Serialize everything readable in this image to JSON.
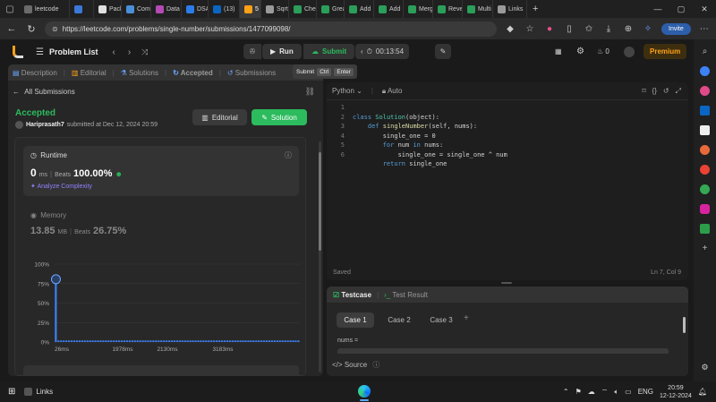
{
  "browser": {
    "tabs": [
      {
        "label": "leetcode",
        "color": "#6b6b6b",
        "active": false
      },
      {
        "label": "",
        "color": "#3b78d8",
        "active": false
      },
      {
        "label": "Packa",
        "color": "#e0e0e0",
        "active": false
      },
      {
        "label": "Com",
        "color": "#4a90d9",
        "active": false
      },
      {
        "label": "Data",
        "color": "#b44ab4",
        "active": false
      },
      {
        "label": "DSA",
        "color": "#2b7de9",
        "active": false
      },
      {
        "label": "(13)",
        "color": "#0a66c2",
        "active": false
      },
      {
        "label": "5",
        "color": "#ffa116",
        "active": true
      },
      {
        "label": "Sqrti",
        "color": "#9a9a9a",
        "active": false
      },
      {
        "label": "Chec",
        "color": "#2b9e5a",
        "active": false
      },
      {
        "label": "Grea",
        "color": "#2b9e5a",
        "active": false
      },
      {
        "label": "Add",
        "color": "#2b9e5a",
        "active": false
      },
      {
        "label": "Add",
        "color": "#2b9e5a",
        "active": false
      },
      {
        "label": "Merg",
        "color": "#2b9e5a",
        "active": false
      },
      {
        "label": "Reve",
        "color": "#2b9e5a",
        "active": false
      },
      {
        "label": "Multi",
        "color": "#2b9e5a",
        "active": false
      },
      {
        "label": "Links",
        "color": "#9a9a9a",
        "active": false
      }
    ],
    "url": "https://leetcode.com/problems/single-number/submissions/1477099098/",
    "invite_label": "Invite"
  },
  "lc_header": {
    "problem_list": "Problem List",
    "run": "Run",
    "submit": "Submit",
    "timer": "00:13:54",
    "streak": "0",
    "premium": "Premium"
  },
  "left_tabs": [
    "Description",
    "Editorial",
    "Solutions",
    "Accepted",
    "Submissions"
  ],
  "shortcut": {
    "label": "Submit",
    "k1": "Ctrl",
    "k2": "Enter"
  },
  "submission": {
    "back": "All Submissions",
    "status": "Accepted",
    "user": "Hariprasath7",
    "submitted": "submitted at Dec 12, 2024 20:59",
    "editorial_btn": "Editorial",
    "solution_btn": "Solution"
  },
  "runtime": {
    "title": "Runtime",
    "value": "0",
    "unit": "ms",
    "beats_label": "Beats",
    "beats_value": "100.00%",
    "analyze": "Analyze Complexity"
  },
  "memory": {
    "title": "Memory",
    "value": "13.85",
    "unit": "MB",
    "beats_label": "Beats",
    "beats_value": "26.75%"
  },
  "chart_data": {
    "type": "bar",
    "title": "",
    "y_ticks": [
      "100%",
      "75%",
      "50%",
      "25%",
      "0%"
    ],
    "x_ticks": [
      "26ms",
      "1978ms",
      "2130ms",
      "3183ms"
    ],
    "ylim": [
      0,
      100
    ],
    "values": [
      76,
      2,
      2,
      2,
      2,
      2,
      2,
      2,
      2,
      2,
      2,
      2,
      2,
      2,
      2,
      2,
      2,
      2,
      2,
      2,
      2,
      2,
      2,
      2,
      2,
      2,
      2,
      2,
      2,
      2,
      2,
      2,
      2,
      2,
      2,
      2,
      2,
      2,
      2,
      2,
      2,
      2,
      2,
      2,
      2,
      2,
      2,
      2,
      2,
      2,
      2,
      2,
      2,
      2,
      2,
      2,
      2,
      2,
      2,
      2,
      2,
      2,
      2,
      2,
      2,
      2,
      2,
      2,
      2,
      2,
      2,
      2,
      2,
      2,
      2,
      2,
      2,
      2,
      2,
      2,
      2,
      2,
      2,
      2,
      2,
      2,
      2,
      2,
      2,
      2,
      2,
      2,
      2
    ],
    "bar_color": "#3b82f6",
    "grid": true
  },
  "editor": {
    "language": "Python",
    "mode": "Auto",
    "lines": [
      "class Solution(object):",
      "    def singleNumber(self, nums):",
      "        single_one = 0",
      "        for num in nums:",
      "            single_one = single_one ^ num",
      "        return single_one"
    ],
    "saved": "Saved",
    "position": "Ln 7, Col 9"
  },
  "testcase": {
    "tab1": "Testcase",
    "tab2": "Test Result",
    "cases": [
      "Case 1",
      "Case 2",
      "Case 3"
    ],
    "add": "+",
    "field": "nums =",
    "source": "Source"
  },
  "taskbar": {
    "app": "Links",
    "lang": "ENG",
    "time": "20:59",
    "date": "12-12-2024"
  }
}
